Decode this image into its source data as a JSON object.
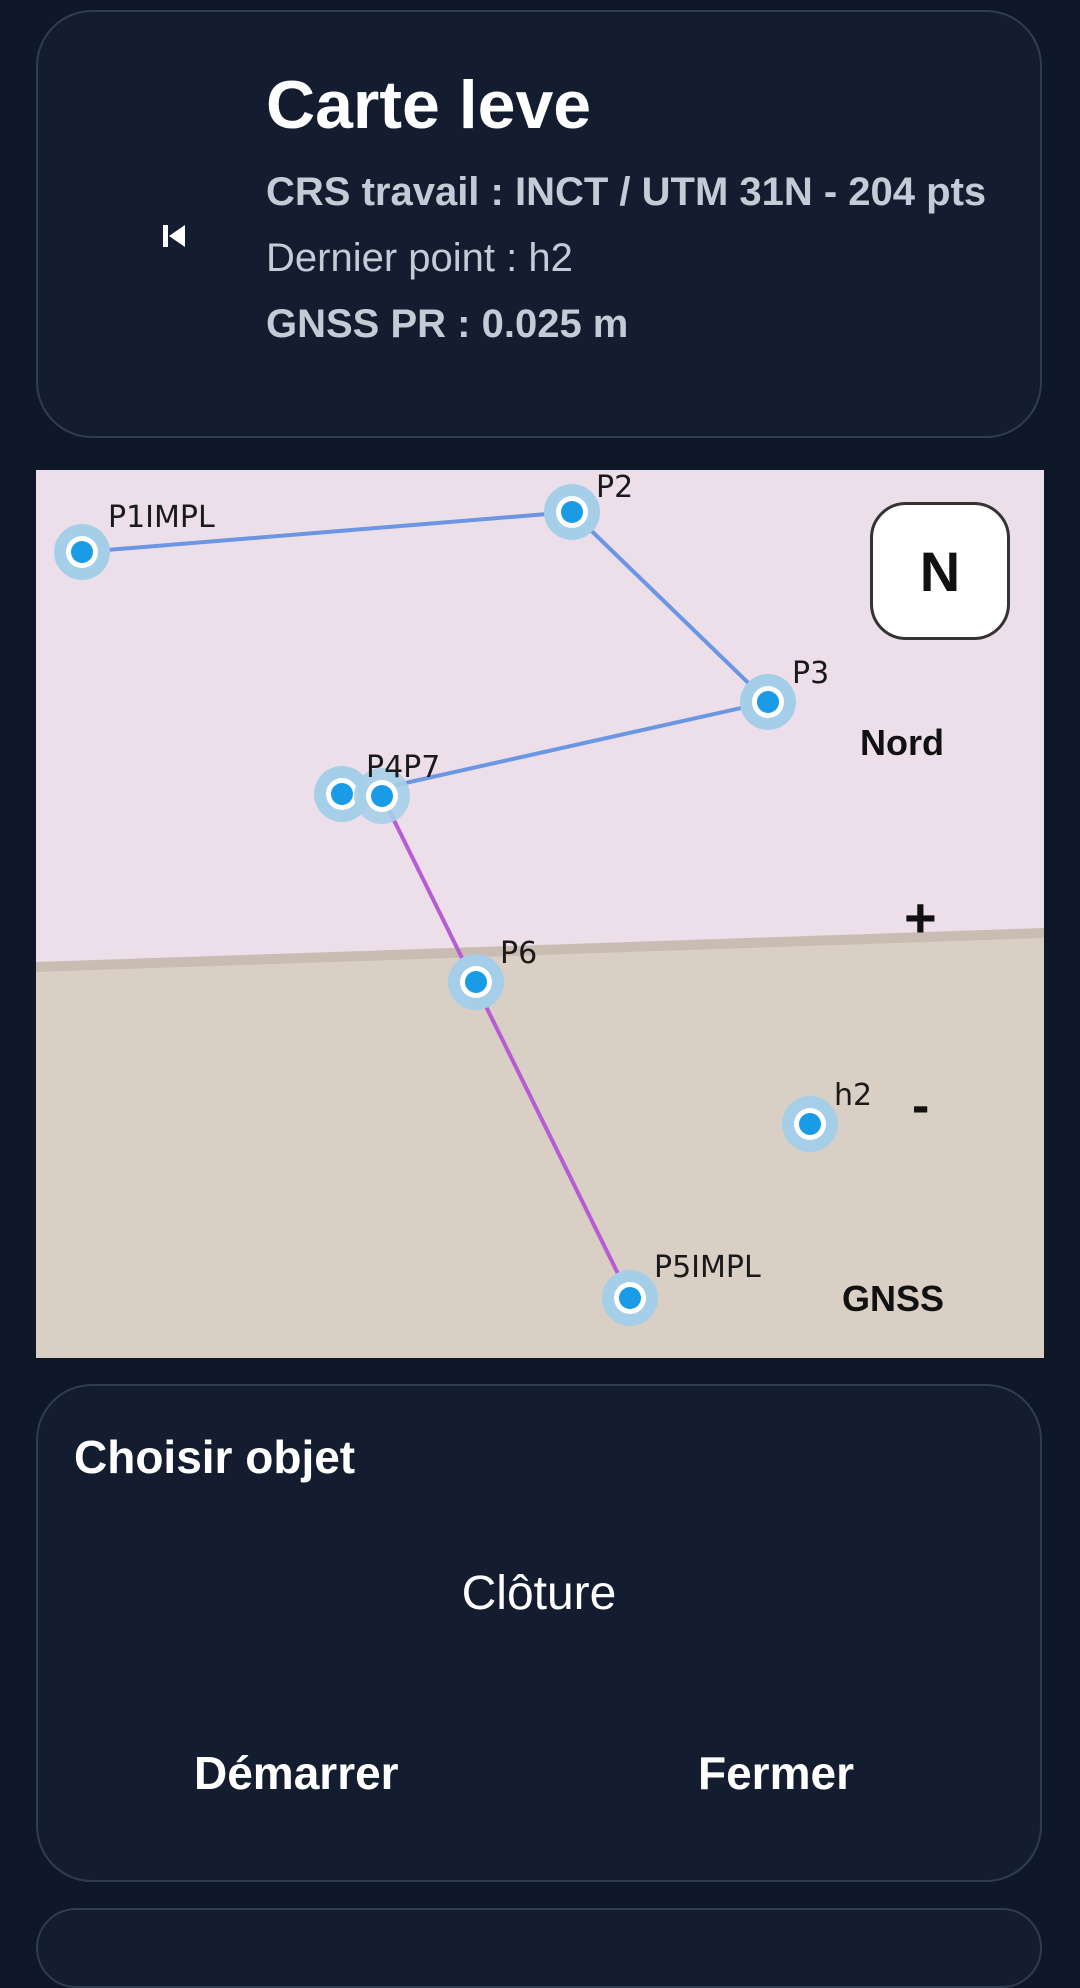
{
  "header": {
    "title": "Carte leve",
    "crs": "CRS travail : INCT / UTM 31N - 204 pts",
    "last_point": "Dernier point : h2",
    "gnss_pr": "GNSS PR : 0.025 m",
    "back_icon": "skip-previous-icon"
  },
  "map": {
    "north_label": "N",
    "nord_label": "Nord",
    "zoom_in_label": "+",
    "zoom_out_label": "-",
    "gnss_label": "GNSS",
    "colors": {
      "upper_area": "#ecdfe9",
      "lower_area": "#d9cfc5",
      "blue_line": "#6b96e3",
      "purple_line": "#b65dd4",
      "point": "#1a9be6",
      "point_halo": "#a5cfe8"
    },
    "points": [
      {
        "label": "P1IMPL"
      },
      {
        "label": "P2"
      },
      {
        "label": "P3"
      },
      {
        "label": "P4P7"
      },
      {
        "label": "P6"
      },
      {
        "label": "h2"
      },
      {
        "label": "P5IMPL"
      }
    ]
  },
  "chooser": {
    "title": "Choisir objet",
    "option": "Clôture",
    "start_label": "Démarrer",
    "close_label": "Fermer"
  }
}
